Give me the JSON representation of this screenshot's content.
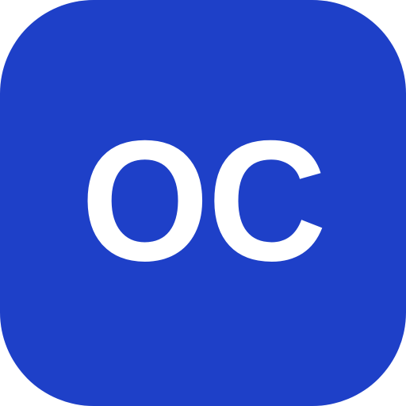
{
  "icon": {
    "label": "OC",
    "background_color": "#1E40C8",
    "text_color": "#FFFFFF"
  }
}
